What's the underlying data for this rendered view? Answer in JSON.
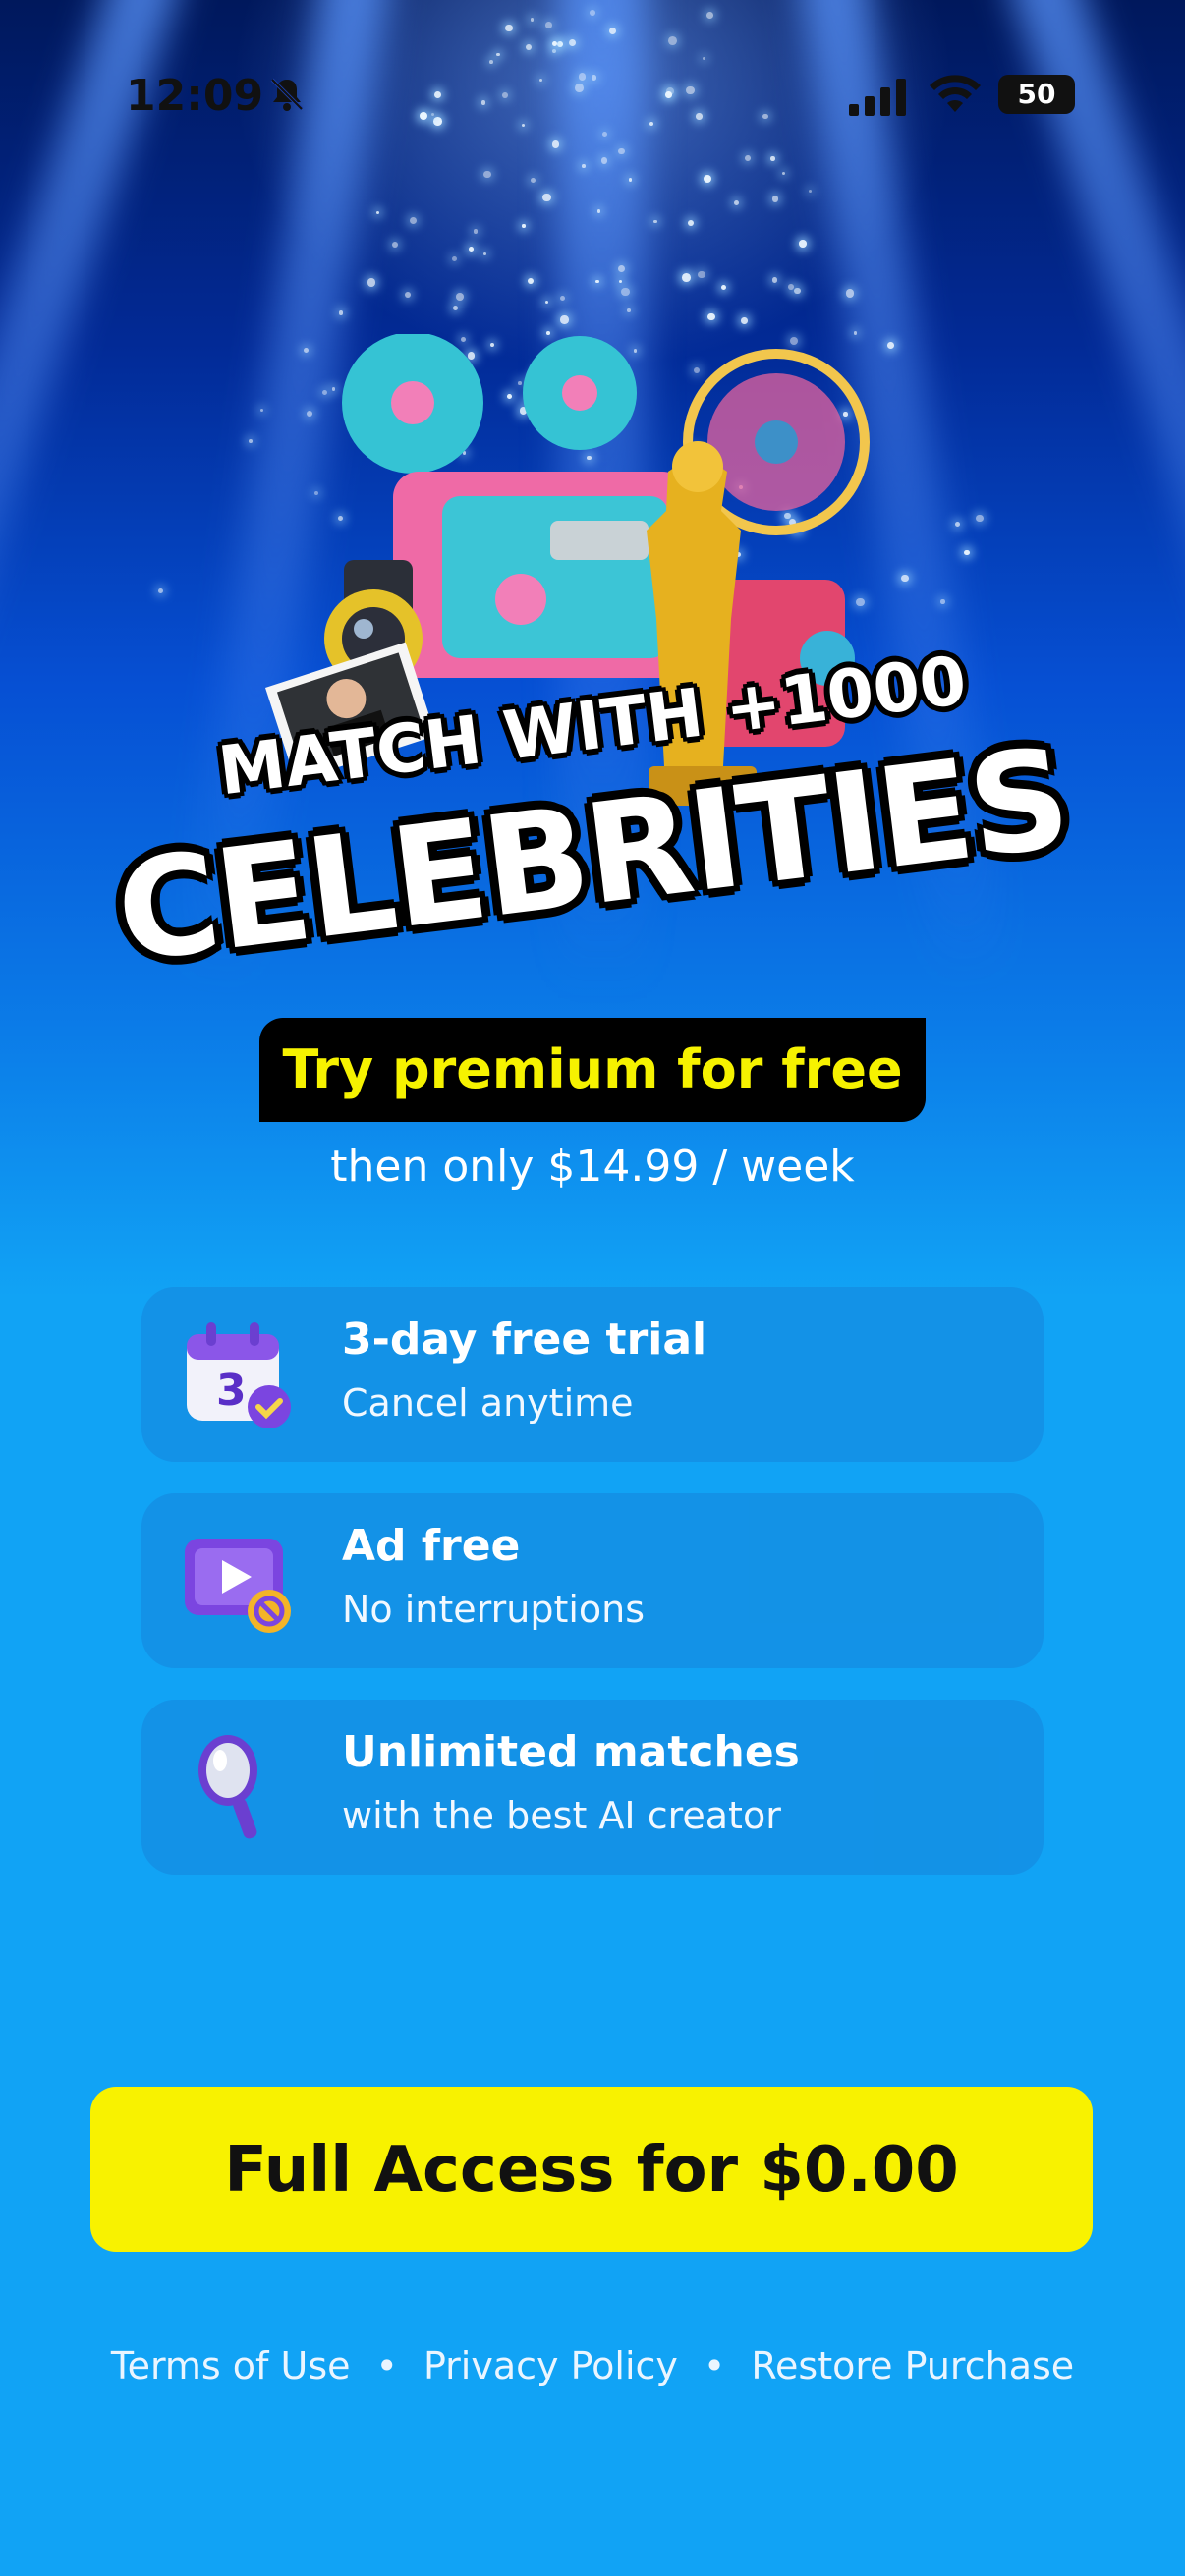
{
  "status_bar": {
    "time": "12:09",
    "battery": "50",
    "icons": [
      "bell-slash-icon",
      "signal-icon",
      "wifi-icon",
      "battery-icon"
    ]
  },
  "hero": {
    "headline_top": "MATCH WITH +1000",
    "headline_main": "CELEBRITIES",
    "try_badge": "Try premium for free",
    "price_line": "then only $14.99 / week"
  },
  "features": [
    {
      "title": "3-day free trial",
      "subtitle": "Cancel anytime",
      "icon": "calendar-check-icon"
    },
    {
      "title": "Ad free",
      "subtitle": "No interruptions",
      "icon": "ad-block-icon"
    },
    {
      "title": "Unlimited matches",
      "subtitle": "with the best AI creator",
      "icon": "mirror-icon"
    }
  ],
  "cta": {
    "label": "Full Access for $0.00"
  },
  "footer": {
    "terms": "Terms of Use",
    "privacy": "Privacy Policy",
    "restore": "Restore Purchase",
    "separator": "•"
  },
  "colors": {
    "accent_yellow": "#f8f200",
    "background_blue": "#11a3f5",
    "badge_black": "#000000"
  }
}
